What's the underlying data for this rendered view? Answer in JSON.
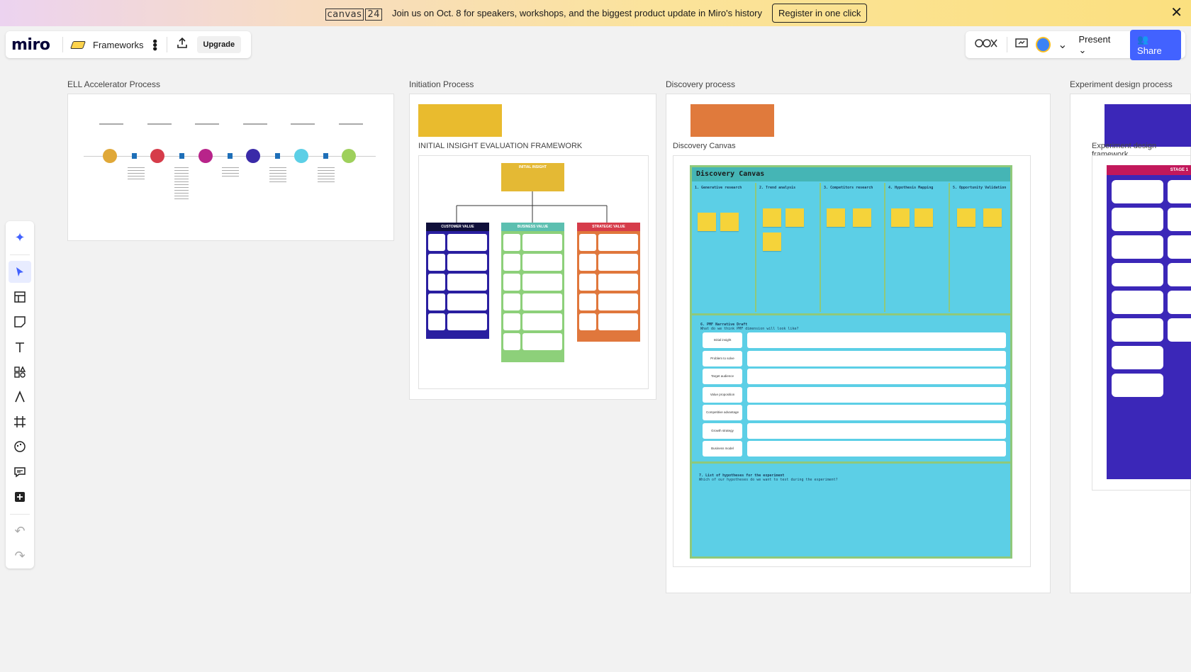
{
  "banner": {
    "event_logo": "canvas",
    "event_year": "24",
    "message": "Join us on Oct. 8 for speakers, workshops, and the biggest product update in Miro's history",
    "register_label": "Register in one click",
    "close_icon": "close-icon"
  },
  "topbar": {
    "logo": "miro",
    "board_name": "Frameworks",
    "upgrade_label": "Upgrade",
    "present_label": "Present",
    "share_label": "Share"
  },
  "left_toolbar": {
    "tools": [
      "ai-sparkle-icon",
      "select-cursor-icon",
      "templates-icon",
      "sticky-note-icon",
      "text-icon",
      "shapes-icon",
      "pen-icon",
      "frame-icon",
      "sticker-icon",
      "comment-icon",
      "add-more-icon",
      "undo-icon",
      "redo-icon"
    ]
  },
  "frames": {
    "ell": {
      "label": "ELL Accelerator Process"
    },
    "initiation": {
      "label": "Initiation Process",
      "framework_title": "INITIAL INSIGHT EVALUATION FRAMEWORK",
      "header_box": "INITIAL INSIGHT",
      "columns": [
        "CUSTOMER VALUE",
        "BUSINESS VALUE",
        "STRATEGIC VALUE"
      ]
    },
    "discovery": {
      "label": "Discovery process",
      "canvas_label": "Discovery Canvas",
      "canvas_title": "Discovery Canvas",
      "columns": [
        "1. Generative research",
        "2. Trend analysis",
        "3. Competitors research",
        "4. Hypothesis Mapping",
        "5. Opportunity Validation"
      ],
      "section6_title": "6. PMF Narrative Draft",
      "section6_sub": "What do we think PMF dimension will look like?",
      "rows": [
        "Initial insight",
        "Problem to solve",
        "Target audience",
        "Value proposition",
        "Competitive advantage",
        "Growth strategy",
        "Business model"
      ],
      "section7_title": "7. List of hypotheses for the experiment",
      "section7_sub": "Which of our hypotheses do we want to test during the experiment?"
    },
    "experiment": {
      "label": "Experiment design process",
      "sub_label": "Experiment design framework",
      "stage_header": "STAGE 1"
    }
  },
  "colors": {
    "accent": "#4262ff",
    "discovery_bg": "#5ccfe6",
    "sticky": "#f5d33a",
    "customer": "#1a1a7a",
    "business": "#5cbfb0",
    "strategic": "#e0553c"
  }
}
